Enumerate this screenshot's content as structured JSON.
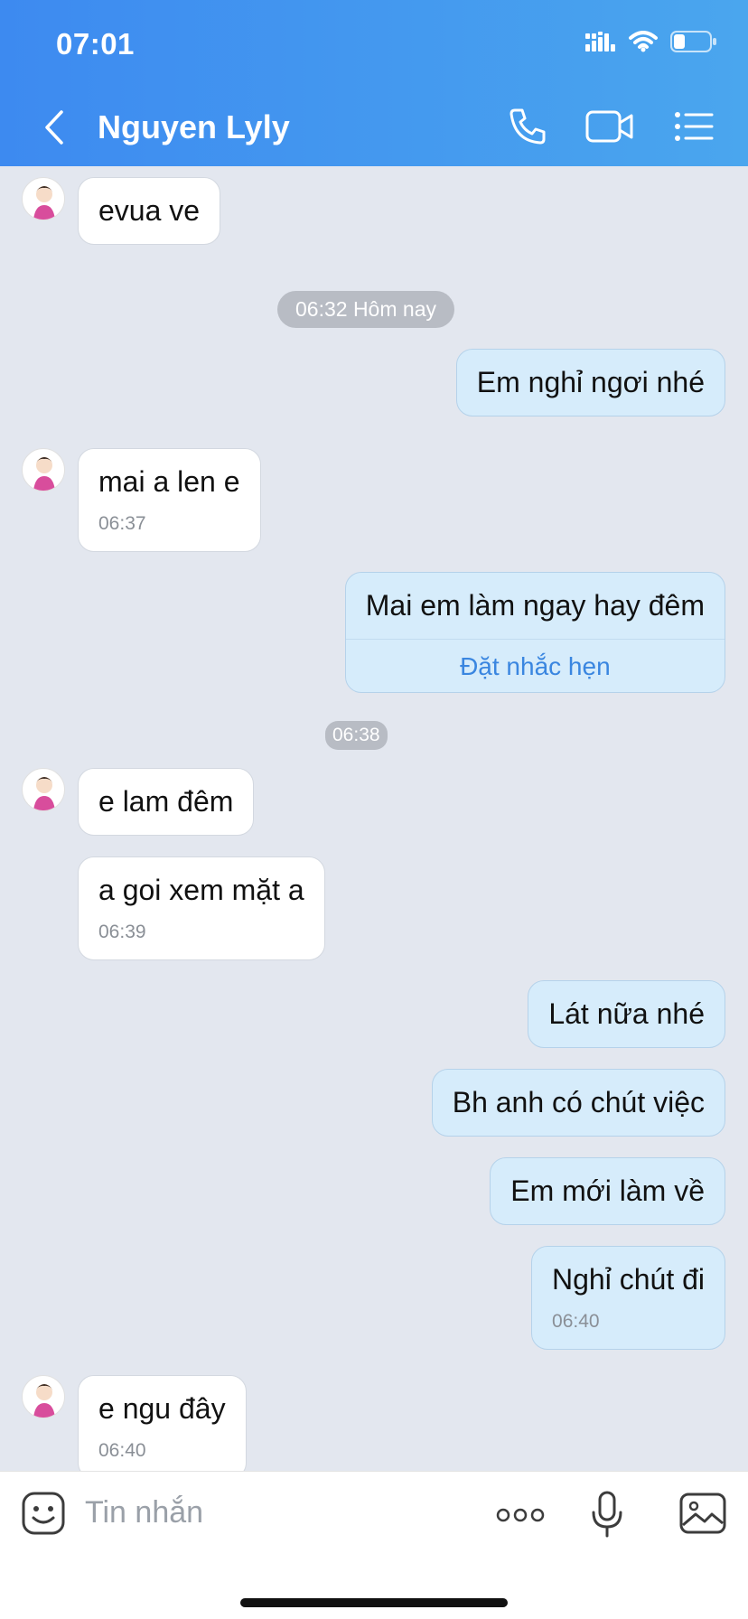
{
  "status": {
    "time": "07:01"
  },
  "header": {
    "title": "Nguyen Lyly"
  },
  "chat": {
    "timestamp_pill": "06:32 Hôm nay",
    "messages": [
      {
        "text": "evua ve",
        "time": ""
      },
      {
        "text": "Em nghỉ ngơi nhé",
        "time": ""
      },
      {
        "text": "mai a len e",
        "time": "06:37"
      },
      {
        "text": "Mai em làm ngay hay đêm",
        "time": "",
        "action": "Đặt nhắc hẹn",
        "outside_time": "06:38"
      },
      {
        "text": "e lam đêm",
        "time": ""
      },
      {
        "text": "a goi xem mặt a",
        "time": "06:39"
      },
      {
        "text": "Lát nữa nhé",
        "time": ""
      },
      {
        "text": "Bh anh có chút việc",
        "time": ""
      },
      {
        "text": "Em mới làm về",
        "time": ""
      },
      {
        "text": "Nghỉ chút đi",
        "time": "06:40"
      },
      {
        "text": "e ngu đây",
        "time": "06:40"
      }
    ]
  },
  "composer": {
    "placeholder": "Tin nhắn"
  },
  "colors": {
    "header_start": "#3d8af0",
    "header_end": "#4aa6ee",
    "outgoing_bubble": "#d6ecfb",
    "incoming_bubble": "#ffffff",
    "chat_background": "#e3e7ef",
    "link": "#3a86e0"
  },
  "icons": [
    "back-icon",
    "phone-icon",
    "video-icon",
    "menu-icon",
    "signal-icon",
    "wifi-icon",
    "battery-icon",
    "sticker-icon",
    "more-icon",
    "mic-icon",
    "image-icon"
  ]
}
